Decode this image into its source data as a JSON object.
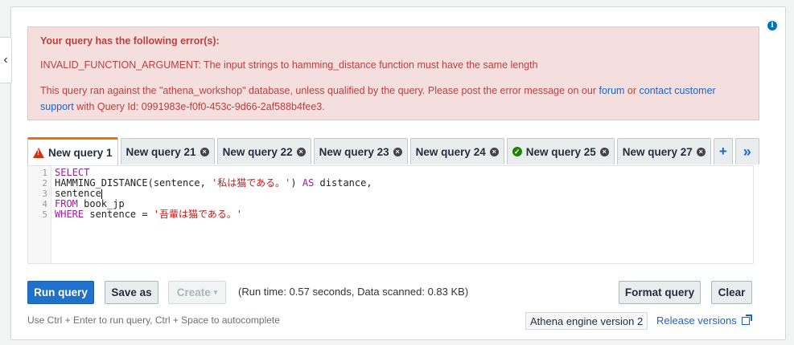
{
  "error": {
    "title": "Your query has the following error(s):",
    "message": "INVALID_FUNCTION_ARGUMENT: The input strings to hamming_distance function must have the same length",
    "detail_pre": "This query ran against the \"athena_workshop\" database, unless qualified by the query. Please post the error message on our ",
    "forum_link": "forum",
    "detail_or": " or ",
    "contact_link": "contact customer support",
    "detail_post": " with Query Id: 0991983e-f0f0-453c-9d66-2af588b4fee3."
  },
  "tabs": [
    {
      "label": "New query 1",
      "state": "error",
      "active": true
    },
    {
      "label": "New query 21",
      "state": "none",
      "active": false
    },
    {
      "label": "New query 22",
      "state": "none",
      "active": false
    },
    {
      "label": "New query 23",
      "state": "none",
      "active": false
    },
    {
      "label": "New query 24",
      "state": "none",
      "active": false
    },
    {
      "label": "New query 25",
      "state": "success",
      "active": false
    },
    {
      "label": "New query 27",
      "state": "none",
      "active": false
    }
  ],
  "tab_icons": {
    "close": "close-icon",
    "add": "plus-icon",
    "more": "double-chevron-right-icon",
    "error": "warning-icon",
    "success": "check-circle-icon"
  },
  "editor": {
    "line_numbers": [
      "1",
      "2",
      "3",
      "4",
      "5"
    ],
    "lines": {
      "l1_kw": "SELECT",
      "l2_a": "HAMMING_DISTANCE(sentence, ",
      "l2_str": "'私は猫である。'",
      "l2_b": ") ",
      "l2_kw": "AS",
      "l2_c": " distance,",
      "l3": "sentence",
      "l4_kw": "FROM",
      "l4_a": " book_jp",
      "l5_kw": "WHERE",
      "l5_a": " sentence = ",
      "l5_str": "'吾輩は猫である。'"
    }
  },
  "actions": {
    "run": "Run query",
    "save_as": "Save as",
    "create": "Create",
    "format": "Format query",
    "clear": "Clear"
  },
  "run_info": "(Run time: 0.57 seconds, Data scanned: 0.83 KB)",
  "hint": "Use Ctrl + Enter to run query, Ctrl + Space to autocomplete",
  "engine_version": "Athena engine version 2",
  "release_versions": "Release versions",
  "colors": {
    "primary": "#1f71c9",
    "error_bg": "#f4dede",
    "error_text": "#b9413e",
    "tab_accent": "#ec7211"
  }
}
